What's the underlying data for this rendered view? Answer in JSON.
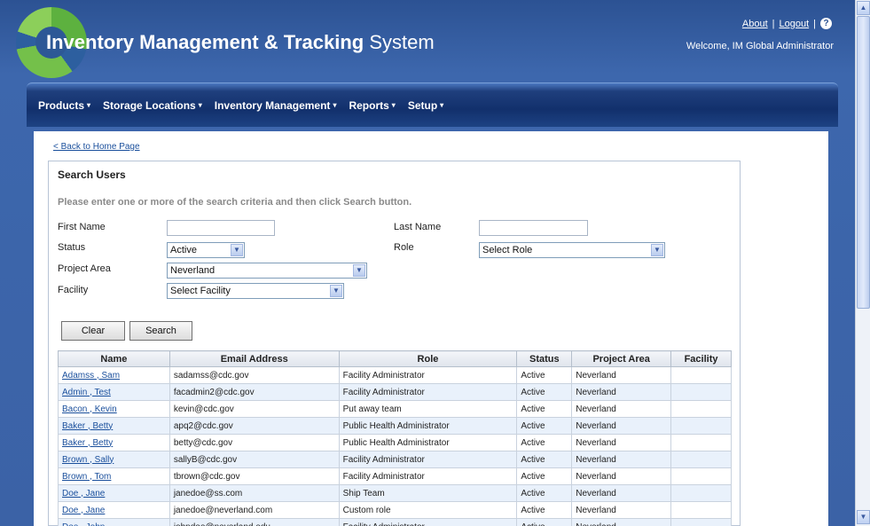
{
  "header": {
    "title_bold": "Inventory Management & Tracking",
    "title_normal": " System",
    "about": "About",
    "logout": "Logout",
    "help_glyph": "?",
    "welcome": "Welcome, IM Global Administrator",
    "separator": "|"
  },
  "nav": {
    "items": [
      {
        "label": "Products"
      },
      {
        "label": "Storage Locations"
      },
      {
        "label": "Inventory Management"
      },
      {
        "label": "Reports"
      },
      {
        "label": "Setup"
      }
    ],
    "caret": "▾"
  },
  "page": {
    "back_link": "< Back to Home Page",
    "search_title": "Search Users",
    "instructions": "Please enter one or more of the search criteria and then click Search button."
  },
  "form": {
    "first_name_label": "First Name",
    "first_name_value": "",
    "last_name_label": "Last Name",
    "last_name_value": "",
    "status_label": "Status",
    "status_value": "Active",
    "role_label": "Role",
    "role_value": "Select Role",
    "project_area_label": "Project Area",
    "project_area_value": "Neverland",
    "facility_label": "Facility",
    "facility_value": "Select Facility",
    "clear_button": "Clear",
    "search_button": "Search"
  },
  "table": {
    "headers": [
      "Name",
      "Email Address",
      "Role",
      "Status",
      "Project Area",
      "Facility"
    ],
    "rows": [
      [
        "Adamss , Sam",
        "sadamss@cdc.gov",
        "Facility Administrator",
        "Active",
        "Neverland",
        ""
      ],
      [
        "Admin , Test",
        "facadmin2@cdc.gov",
        "Facility Administrator",
        "Active",
        "Neverland",
        ""
      ],
      [
        "Bacon , Kevin",
        "kevin@cdc.gov",
        "Put away team",
        "Active",
        "Neverland",
        ""
      ],
      [
        "Baker , Betty",
        "apq2@cdc.gov",
        "Public Health Administrator",
        "Active",
        "Neverland",
        ""
      ],
      [
        "Baker , Betty",
        "betty@cdc.gov",
        "Public Health Administrator",
        "Active",
        "Neverland",
        ""
      ],
      [
        "Brown , Sally",
        "sallyB@cdc.gov",
        "Facility Administrator",
        "Active",
        "Neverland",
        ""
      ],
      [
        "Brown , Tom",
        "tbrown@cdc.gov",
        "Facility Administrator",
        "Active",
        "Neverland",
        ""
      ],
      [
        "Doe , Jane",
        "janedoe@ss.com",
        "Ship Team",
        "Active",
        "Neverland",
        ""
      ],
      [
        "Doe , Jane",
        "janedoe@neverland.com",
        "Custom role",
        "Active",
        "Neverland",
        ""
      ],
      [
        "Doe , John",
        "johndoe@neverland.edu",
        "Facility Administrator",
        "Active",
        "Neverland",
        ""
      ]
    ]
  },
  "scrollbar": {
    "up": "▲",
    "down": "▼",
    "grip": "≡"
  }
}
